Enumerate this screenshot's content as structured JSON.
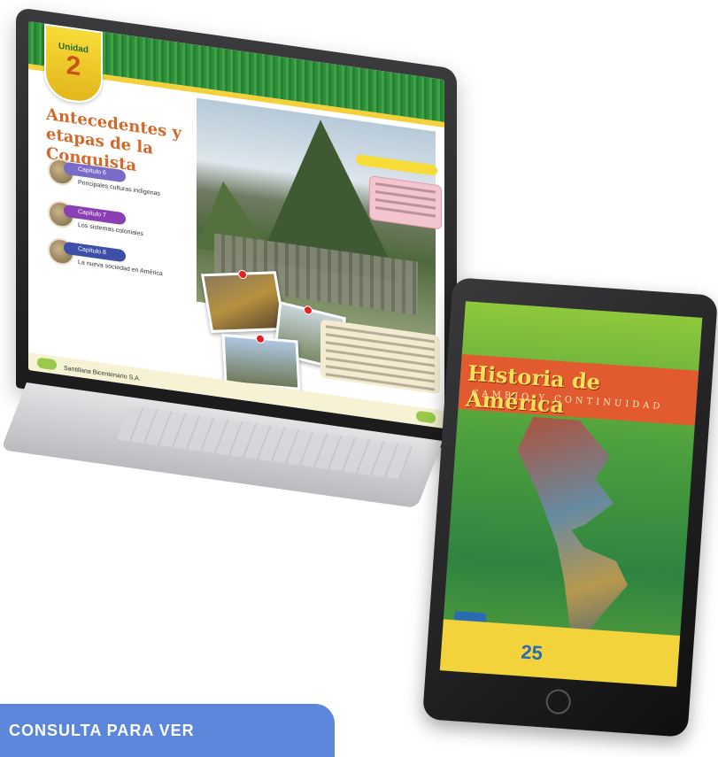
{
  "laptop_page": {
    "unit_label": "Unidad",
    "unit_number": "2",
    "title": "Antecedentes y etapas de la Conquista",
    "chapters": [
      {
        "pill": "Capítulo 6",
        "desc": "Principales culturas indígenas",
        "color": "#7a6bc8"
      },
      {
        "pill": "Capítulo 7",
        "desc": "Los sistemas coloniales",
        "color": "#8a3fb3"
      },
      {
        "pill": "Capítulo 8",
        "desc": "La nueva sociedad en América",
        "color": "#3e4fa8"
      }
    ],
    "footer_label": "Santillana Bicentenario S.A."
  },
  "tablet_cover": {
    "title": "Historia de América",
    "subtitle": "CAMBIO Y CONTINUIDAD"
  },
  "banner": {
    "text": "CONSULTA PARA VER",
    "color": "#5b86d9"
  }
}
